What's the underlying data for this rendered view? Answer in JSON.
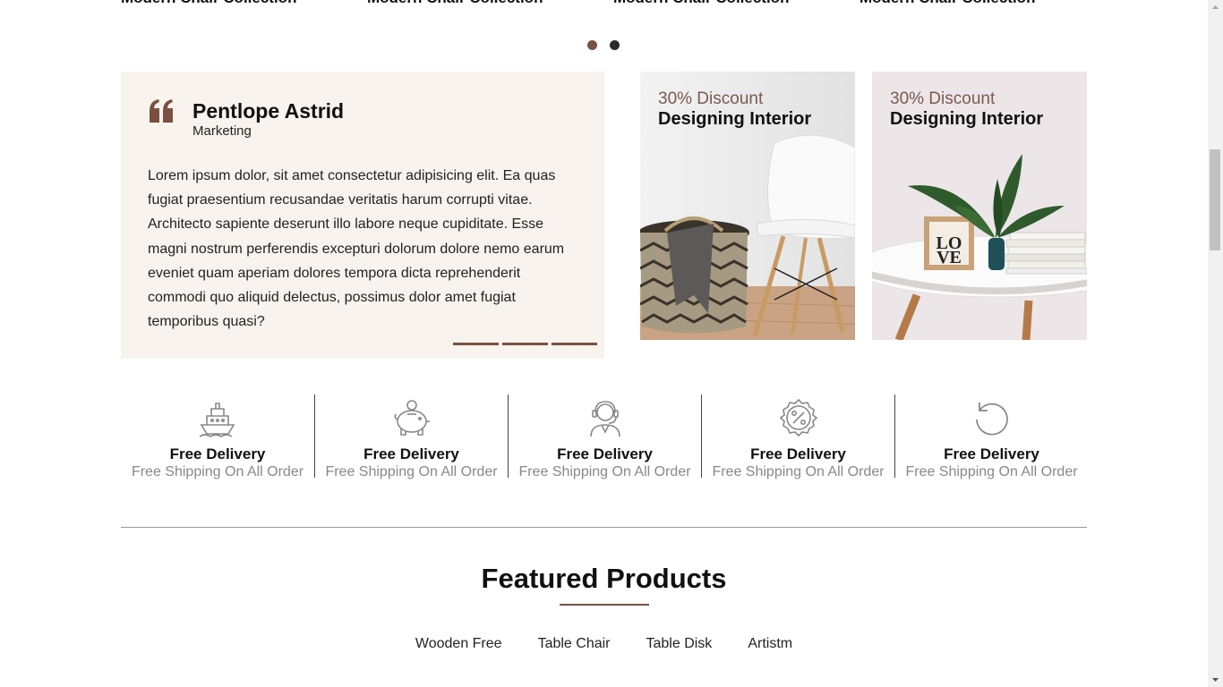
{
  "top_titles": [
    "Modern Chair Collection",
    "Modern Chair Collection",
    "Modern Chair Collection",
    "Modern Chair Collection"
  ],
  "carousel": {
    "dot_count": 2,
    "active_index": 0
  },
  "testimonial": {
    "name": "Pentlope Astrid",
    "role": "Marketing",
    "body": "Lorem ipsum dolor, sit amet consectetur adipisicing elit. Ea quas fugiat praesentium recusandae veritatis harum corrupti vitae. Architecto sapiente deserunt illo labore neque cupiditate. Esse magni nostrum perferendis excepturi dolorum dolore nemo earum eveniet quam aperiam dolores tempora dicta reprehenderit commodi quo aliquid delectus, possimus dolor amet fugiat temporibus quasi?"
  },
  "banners": [
    {
      "discount": "30% Discount",
      "title": "Designing Interior"
    },
    {
      "discount": "30% Discount",
      "title": "Designing Interior"
    }
  ],
  "features": [
    {
      "icon": "ship-icon",
      "title": "Free Delivery",
      "subtitle": "Free Shipping On All Order"
    },
    {
      "icon": "piggy-bank-icon",
      "title": "Free Delivery",
      "subtitle": "Free Shipping On All Order"
    },
    {
      "icon": "support-agent-icon",
      "title": "Free Delivery",
      "subtitle": "Free Shipping On All Order"
    },
    {
      "icon": "discount-badge-icon",
      "title": "Free Delivery",
      "subtitle": "Free Shipping On All Order"
    },
    {
      "icon": "return-arrow-icon",
      "title": "Free Delivery",
      "subtitle": "Free Shipping On All Order"
    }
  ],
  "featured": {
    "title": "Featured Products",
    "tabs": [
      "Wooden Free",
      "Table Chair",
      "Table Disk",
      "Artistm"
    ]
  },
  "colors": {
    "accent": "#7a5040",
    "testimonial_bg": "#f8f3ee",
    "muted_text": "#888888"
  }
}
